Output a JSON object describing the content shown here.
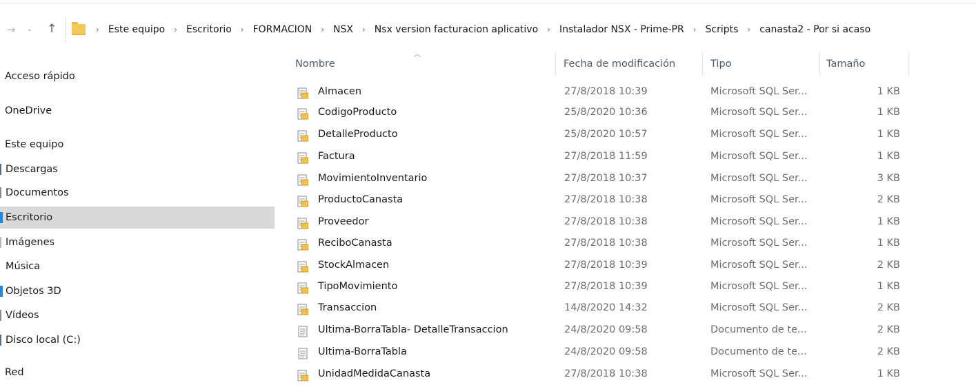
{
  "colors": {
    "folder": "#f5c85a",
    "selected_bg": "#d9d9d9",
    "header_text": "#4a5a6e",
    "meta_text": "#6d6d6d",
    "accent_pin": "#1e88e5"
  },
  "nav": {
    "back_icon": "arrow-right-icon",
    "dropdown_icon": "chevron-down-icon",
    "up_icon": "arrow-up-icon"
  },
  "breadcrumb": [
    "Este equipo",
    "Escritorio",
    "FORMACION",
    "NSX",
    "Nsx version facturacion aplicativo",
    "Instalador NSX - Prime-PR",
    "Scripts",
    "canasta2 - Por si acaso"
  ],
  "sidebar": [
    {
      "label": "Acceso rápido",
      "level": 0,
      "selected": false,
      "icon_color": ""
    },
    {
      "label": "OneDrive",
      "level": 0,
      "selected": false,
      "icon_color": ""
    },
    {
      "label": "Este equipo",
      "level": 0,
      "selected": false,
      "icon_color": ""
    },
    {
      "label": "Descargas",
      "level": 1,
      "selected": false,
      "icon_color": "#5a6b7d"
    },
    {
      "label": "Documentos",
      "level": 1,
      "selected": false,
      "icon_color": "#8a8a8a"
    },
    {
      "label": "Escritorio",
      "level": 1,
      "selected": true,
      "icon_color": "#1e88e5"
    },
    {
      "label": "Imágenes",
      "level": 1,
      "selected": false,
      "icon_color": "#b5b5b5"
    },
    {
      "label": "Música",
      "level": 1,
      "selected": false,
      "icon_color": ""
    },
    {
      "label": "Objetos 3D",
      "level": 1,
      "selected": false,
      "icon_color": "#1e88e5"
    },
    {
      "label": "Vídeos",
      "level": 1,
      "selected": false,
      "icon_color": "#8a8a8a"
    },
    {
      "label": "Disco local (C:)",
      "level": 1,
      "selected": false,
      "icon_color": "#5a6b7d"
    },
    {
      "label": "Red",
      "level": 0,
      "selected": false,
      "icon_color": ""
    }
  ],
  "columns": {
    "name": "Nombre",
    "date": "Fecha de modificación",
    "type": "Tipo",
    "size": "Tamaño"
  },
  "files": [
    {
      "name": "Almacen",
      "date": "27/8/2018 10:39",
      "type": "Microsoft SQL Ser...",
      "size": "1 KB",
      "kind": "sql"
    },
    {
      "name": "CodigoProducto",
      "date": "25/8/2020 10:36",
      "type": "Microsoft SQL Ser...",
      "size": "1 KB",
      "kind": "sql"
    },
    {
      "name": "DetalleProducto",
      "date": "25/8/2020 10:57",
      "type": "Microsoft SQL Ser...",
      "size": "1 KB",
      "kind": "sql"
    },
    {
      "name": "Factura",
      "date": "27/8/2018 11:59",
      "type": "Microsoft SQL Ser...",
      "size": "1 KB",
      "kind": "sql"
    },
    {
      "name": "MovimientoInventario",
      "date": "27/8/2018 10:37",
      "type": "Microsoft SQL Ser...",
      "size": "3 KB",
      "kind": "sql"
    },
    {
      "name": "ProductoCanasta",
      "date": "27/8/2018 10:38",
      "type": "Microsoft SQL Ser...",
      "size": "2 KB",
      "kind": "sql"
    },
    {
      "name": "Proveedor",
      "date": "27/8/2018 10:38",
      "type": "Microsoft SQL Ser...",
      "size": "1 KB",
      "kind": "sql"
    },
    {
      "name": "ReciboCanasta",
      "date": "27/8/2018 10:38",
      "type": "Microsoft SQL Ser...",
      "size": "1 KB",
      "kind": "sql"
    },
    {
      "name": "StockAlmacen",
      "date": "27/8/2018 10:39",
      "type": "Microsoft SQL Ser...",
      "size": "2 KB",
      "kind": "sql"
    },
    {
      "name": "TipoMovimiento",
      "date": "27/8/2018 10:39",
      "type": "Microsoft SQL Ser...",
      "size": "1 KB",
      "kind": "sql"
    },
    {
      "name": "Transaccion",
      "date": "14/8/2020 14:32",
      "type": "Microsoft SQL Ser...",
      "size": "2 KB",
      "kind": "sql"
    },
    {
      "name": "Ultima-BorraTabla- DetalleTransaccion",
      "date": "24/8/2020 09:58",
      "type": "Documento de te...",
      "size": "2 KB",
      "kind": "txt"
    },
    {
      "name": "Ultima-BorraTabla",
      "date": "24/8/2020 09:58",
      "type": "Documento de te...",
      "size": "2 KB",
      "kind": "txt"
    },
    {
      "name": "UnidadMedidaCanasta",
      "date": "27/8/2018 10:38",
      "type": "Microsoft SQL Ser...",
      "size": "1 KB",
      "kind": "sql"
    }
  ]
}
